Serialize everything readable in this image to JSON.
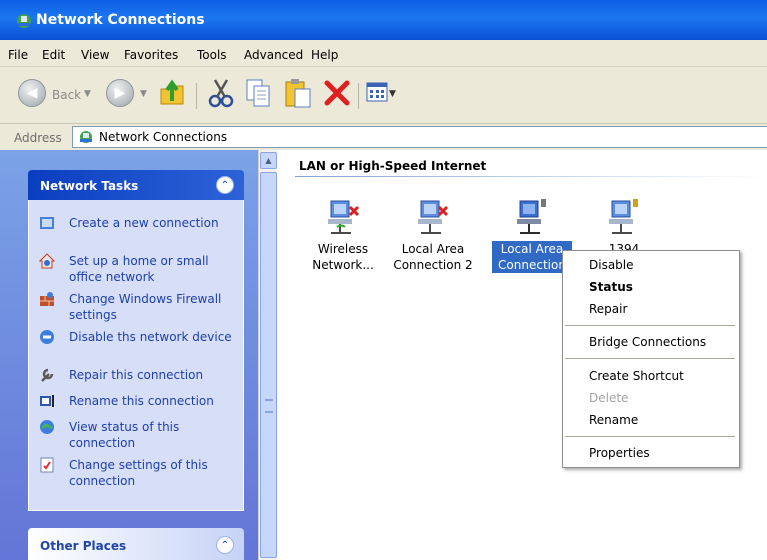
{
  "window": {
    "title": "Network Connections"
  },
  "menubar": [
    "File",
    "Edit",
    "View",
    "Favorites",
    "Tools",
    "Advanced",
    "Help"
  ],
  "toolbar": {
    "back_label": "Back"
  },
  "address": {
    "label": "Address",
    "value": "Network Connections"
  },
  "network_tasks": {
    "title": "Network Tasks",
    "items": [
      "Create a new connection",
      "Set up a home or small office network",
      "Change Windows Firewall settings",
      "Disable ths network device",
      "Repair this connection",
      "Rename this connection",
      "View status of this connection",
      "Change settings of this connection"
    ]
  },
  "other_places": {
    "title": "Other Places"
  },
  "content": {
    "group_title": "LAN or High-Speed Internet",
    "items": [
      {
        "line1": "Wireless",
        "line2": "Network..."
      },
      {
        "line1": "Local Area",
        "line2": "Connection 2"
      },
      {
        "line1": "Local Area",
        "line2": "Connection"
      },
      {
        "line1": "1394",
        "line2": ""
      }
    ]
  },
  "context_menu": {
    "items": [
      "Disable",
      "Status",
      "Repair",
      "Bridge Connections",
      "Create Shortcut",
      "Delete",
      "Rename",
      "Properties"
    ]
  },
  "colors": {
    "title_bar": "#0a5ee6",
    "task_pane": "#6375d6",
    "selection": "#316ac5",
    "link_text": "#1e3fa8"
  }
}
